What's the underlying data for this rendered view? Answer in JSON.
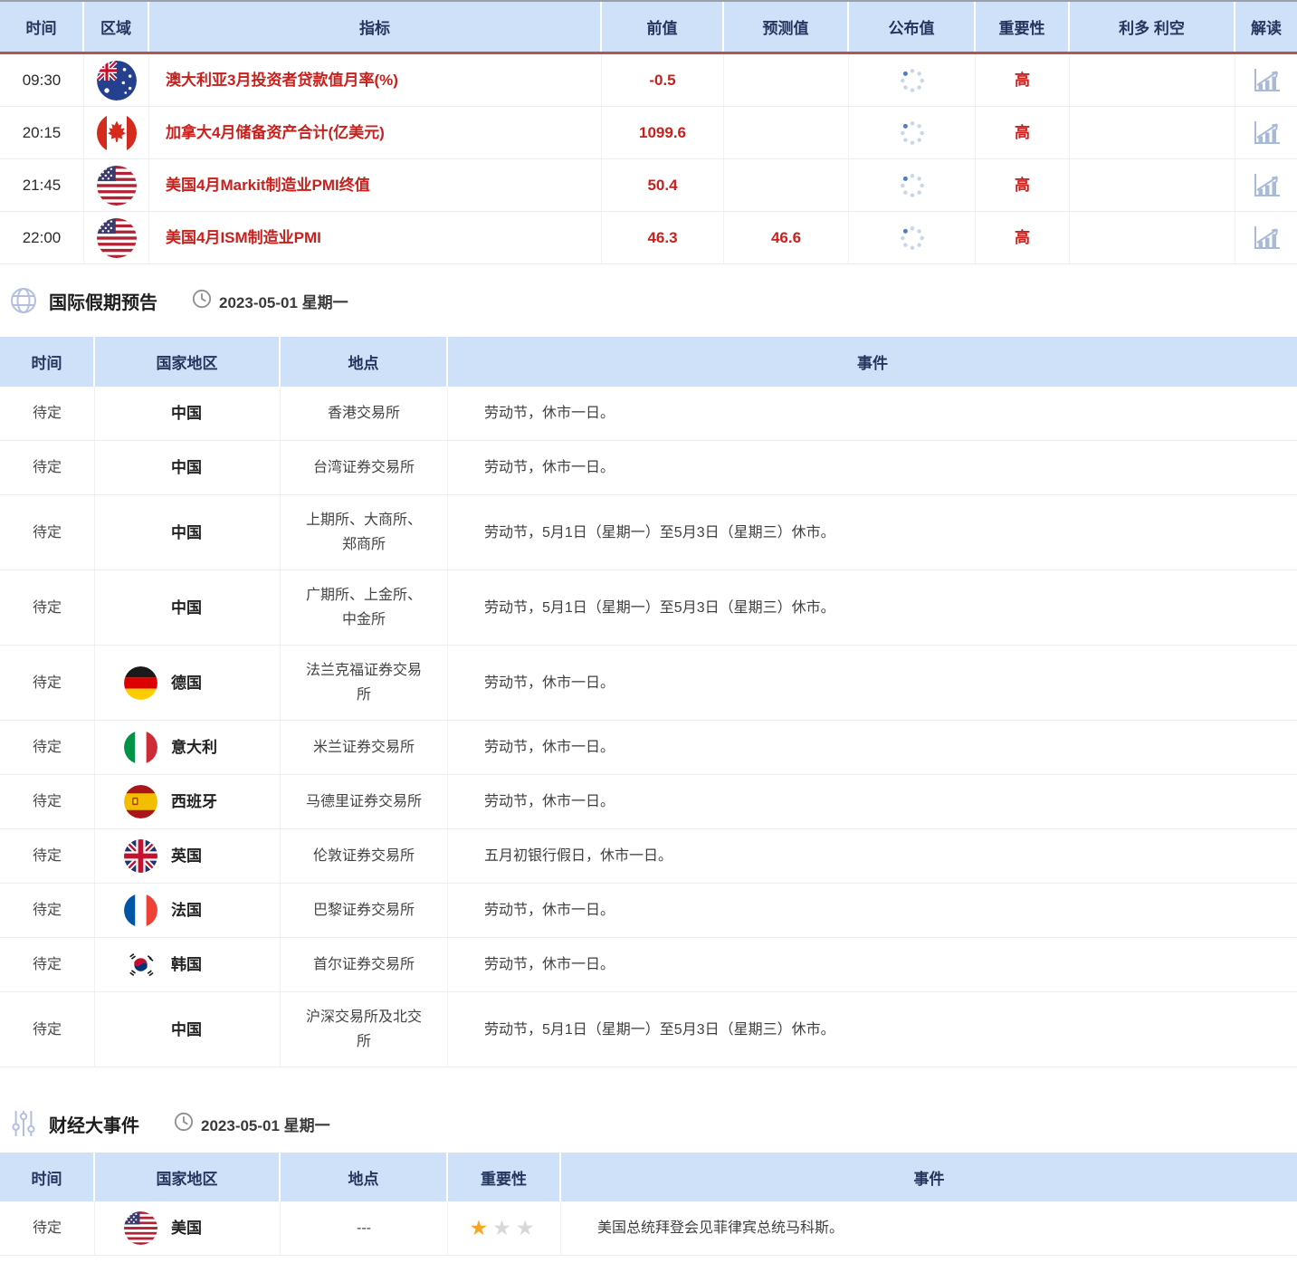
{
  "colors": {
    "header_bg": "#cfe1f9",
    "header_text": "#24355e",
    "accent_red": "#c8201d",
    "header_divider_red": "#b4564f",
    "star_gold": "#f5a623",
    "star_gray": "#d8d8d8",
    "icon_blue": "#b3c0de"
  },
  "calendar_table": {
    "headers": {
      "time": "时间",
      "region": "区域",
      "indicator": "指标",
      "previous": "前值",
      "forecast": "预测值",
      "published": "公布值",
      "importance": "重要性",
      "bull_bear": "利多 利空",
      "interpret": "解读"
    },
    "rows": [
      {
        "time": "09:30",
        "flag": "australia",
        "indicator": "澳大利亚3月投资者贷款值月率(%)",
        "previous": "-0.5",
        "forecast": "",
        "published": "loading",
        "importance": "高"
      },
      {
        "time": "20:15",
        "flag": "canada",
        "indicator": "加拿大4月储备资产合计(亿美元)",
        "previous": "1099.6",
        "forecast": "",
        "published": "loading",
        "importance": "高"
      },
      {
        "time": "21:45",
        "flag": "usa",
        "indicator": "美国4月Markit制造业PMI终值",
        "previous": "50.4",
        "forecast": "",
        "published": "loading",
        "importance": "高"
      },
      {
        "time": "22:00",
        "flag": "usa",
        "indicator": "美国4月ISM制造业PMI",
        "previous": "46.3",
        "forecast": "46.6",
        "published": "loading",
        "importance": "高"
      }
    ]
  },
  "holiday_section": {
    "title": "国际假期预告",
    "date": "2023-05-01 星期一"
  },
  "holiday_table": {
    "headers": {
      "time": "时间",
      "country": "国家地区",
      "place": "地点",
      "event": "事件"
    },
    "rows": [
      {
        "time": "待定",
        "flag": "",
        "country": "中国",
        "place": "香港交易所",
        "event": "劳动节，休市一日。"
      },
      {
        "time": "待定",
        "flag": "",
        "country": "中国",
        "place": "台湾证券交易所",
        "event": "劳动节，休市一日。"
      },
      {
        "time": "待定",
        "flag": "",
        "country": "中国",
        "place": "上期所、大商所、郑商所",
        "event": "劳动节，5月1日（星期一）至5月3日（星期三）休市。"
      },
      {
        "time": "待定",
        "flag": "",
        "country": "中国",
        "place": "广期所、上金所、中金所",
        "event": "劳动节，5月1日（星期一）至5月3日（星期三）休市。"
      },
      {
        "time": "待定",
        "flag": "germany",
        "country": "德国",
        "place": "法兰克福证券交易所",
        "event": "劳动节，休市一日。"
      },
      {
        "time": "待定",
        "flag": "italy",
        "country": "意大利",
        "place": "米兰证券交易所",
        "event": "劳动节，休市一日。"
      },
      {
        "time": "待定",
        "flag": "spain",
        "country": "西班牙",
        "place": "马德里证券交易所",
        "event": "劳动节，休市一日。"
      },
      {
        "time": "待定",
        "flag": "uk",
        "country": "英国",
        "place": "伦敦证券交易所",
        "event": "五月初银行假日，休市一日。"
      },
      {
        "time": "待定",
        "flag": "france",
        "country": "法国",
        "place": "巴黎证券交易所",
        "event": "劳动节，休市一日。"
      },
      {
        "time": "待定",
        "flag": "korea",
        "country": "韩国",
        "place": "首尔证券交易所",
        "event": "劳动节，休市一日。"
      },
      {
        "time": "待定",
        "flag": "",
        "country": "中国",
        "place": "沪深交易所及北交所",
        "event": "劳动节，5月1日（星期一）至5月3日（星期三）休市。"
      }
    ]
  },
  "events_section": {
    "title": "财经大事件",
    "date": "2023-05-01 星期一"
  },
  "events_table": {
    "headers": {
      "time": "时间",
      "country": "国家地区",
      "place": "地点",
      "importance": "重要性",
      "event": "事件"
    },
    "rows": [
      {
        "time": "待定",
        "flag": "usa",
        "country": "美国",
        "place": "---",
        "importance_stars": 1,
        "stars_total": 3,
        "event": "美国总统拜登会见菲律宾总统马科斯。"
      }
    ]
  }
}
